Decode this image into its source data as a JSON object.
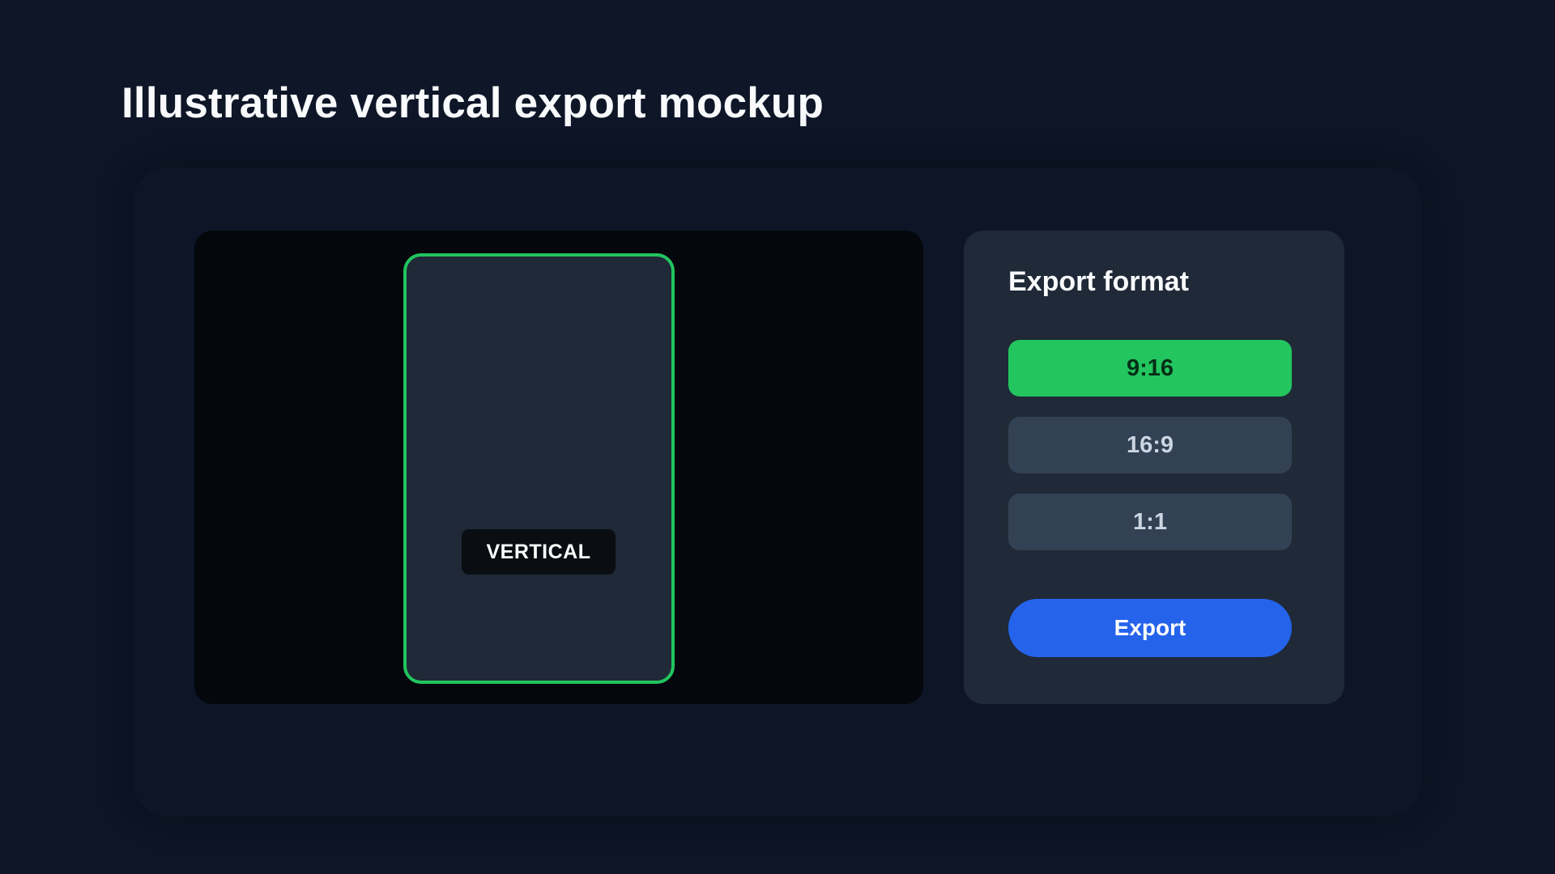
{
  "page": {
    "title": "Illustrative vertical export mockup"
  },
  "preview": {
    "frame_label": "VERTICAL"
  },
  "export_panel": {
    "title": "Export format",
    "options": [
      {
        "label": "9:16",
        "selected": true
      },
      {
        "label": "16:9",
        "selected": false
      },
      {
        "label": "1:1",
        "selected": false
      }
    ],
    "export_label": "Export"
  },
  "colors": {
    "background": "#0e1628",
    "panel": "#1f2937",
    "preview_background": "#04070c",
    "selected_accent": "#22c55e",
    "option_inactive": "#334155",
    "export_button": "#2563eb"
  }
}
